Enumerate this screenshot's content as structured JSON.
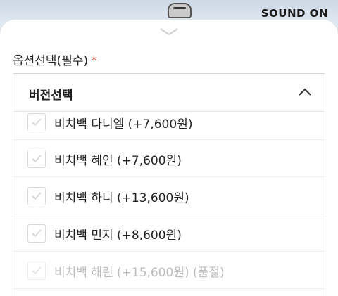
{
  "banner": {
    "sound_label": "SOUND ON"
  },
  "section": {
    "label": "옵션선택(필수)",
    "required_mark": "*"
  },
  "dropdown": {
    "title": "버전선택",
    "options": [
      {
        "label": "비치백 다니엘 (+7,600원)",
        "disabled": false
      },
      {
        "label": "비치백 혜인 (+7,600원)",
        "disabled": false
      },
      {
        "label": "비치백 하니 (+13,600원)",
        "disabled": false
      },
      {
        "label": "비치백 민지 (+8,600원)",
        "disabled": false
      },
      {
        "label": "비치백 해린 (+15,600원) (품절)",
        "disabled": true
      }
    ]
  },
  "colors": {
    "required": "#d9534f",
    "disabled_text": "#bdbdbd",
    "check": "#d0d0d0"
  }
}
